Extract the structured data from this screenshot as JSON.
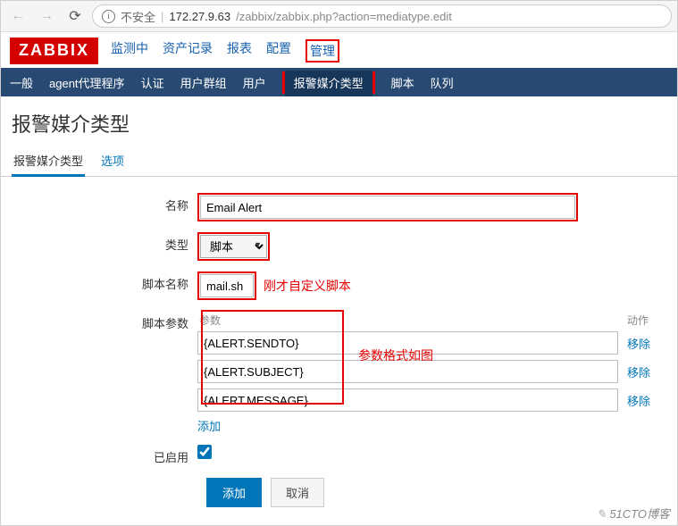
{
  "browser": {
    "insecure_label": "不安全",
    "host": "172.27.9.63",
    "path": "/zabbix/zabbix.php?action=mediatype.edit"
  },
  "logo": "ZABBIX",
  "menu1": [
    "监测中",
    "资产记录",
    "报表",
    "配置",
    "管理"
  ],
  "menu1_active_index": 4,
  "subnav": [
    "一般",
    "agent代理程序",
    "认证",
    "用户群组",
    "用户",
    "报警媒介类型",
    "脚本",
    "队列"
  ],
  "subnav_active_index": 5,
  "page_title": "报警媒介类型",
  "tabs": [
    {
      "label": "报警媒介类型",
      "active": true
    },
    {
      "label": "选项",
      "active": false
    }
  ],
  "form": {
    "name_label": "名称",
    "name_value": "Email Alert",
    "type_label": "类型",
    "type_value": "脚本",
    "script_label": "脚本名称",
    "script_value": "mail.sh",
    "params_label": "脚本参数",
    "params_head_left": "参数",
    "params_head_right": "动作",
    "params": [
      "{ALERT.SENDTO}",
      "{ALERT.SUBJECT}",
      "{ALERT.MESSAGE}"
    ],
    "remove_label": "移除",
    "add_param_label": "添加",
    "enabled_label": "已启用",
    "enabled_checked": true,
    "submit_label": "添加",
    "cancel_label": "取消"
  },
  "annotations": {
    "script_note": "刚才自定义脚本",
    "params_note": "参数格式如图"
  },
  "watermark": "51CTO博客"
}
